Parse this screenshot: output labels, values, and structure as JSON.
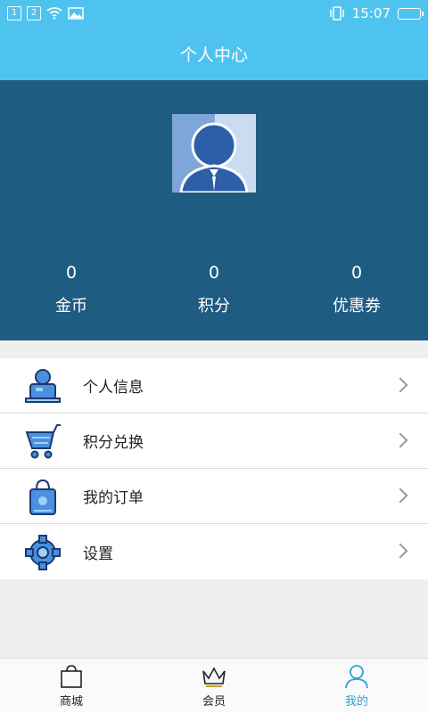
{
  "status_bar": {
    "sim1": "1",
    "sim2": "2",
    "time": "15:07"
  },
  "header": {
    "title": "个人中心"
  },
  "profile": {
    "stats": [
      {
        "value": "0",
        "label": "金币"
      },
      {
        "value": "0",
        "label": "积分"
      },
      {
        "value": "0",
        "label": "优惠券"
      }
    ]
  },
  "menu": {
    "items": [
      {
        "label": "个人信息",
        "icon": "person-at-desk-icon"
      },
      {
        "label": "积分兑换",
        "icon": "shopping-cart-icon"
      },
      {
        "label": "我的订单",
        "icon": "shopping-bag-icon"
      },
      {
        "label": "设置",
        "icon": "gear-icon"
      }
    ]
  },
  "bottom_nav": {
    "items": [
      {
        "label": "商城",
        "icon": "bag-icon"
      },
      {
        "label": "会员",
        "icon": "crown-icon"
      },
      {
        "label": "我的",
        "icon": "user-icon",
        "active": true
      }
    ]
  },
  "colors": {
    "accent": "#4fc3ef",
    "profile_bg": "#1f5c82",
    "active_tab": "#2aa3d8"
  }
}
